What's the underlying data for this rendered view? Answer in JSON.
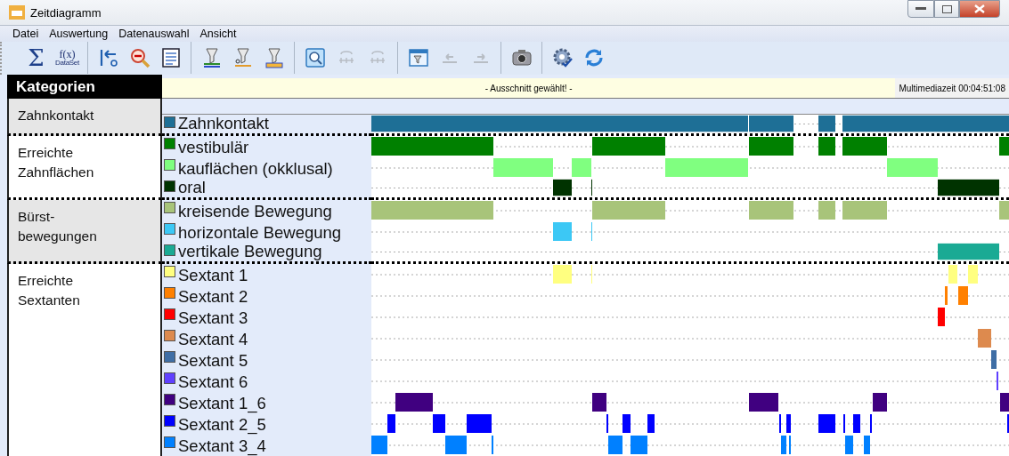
{
  "window": {
    "title": "Zeitdiagramm"
  },
  "menu": [
    "Datei",
    "Auswertung",
    "Datenauswahl",
    "Ansicht"
  ],
  "toolbar": [
    [
      {
        "kind": "sum",
        "text": "Σ",
        "disabled": false
      },
      {
        "kind": "function",
        "text": "f(x)",
        "subtext": "DataSet",
        "disabled": false
      }
    ],
    [
      {
        "kind": "reset",
        "disabled": false
      },
      {
        "kind": "zoom-out",
        "disabled": false
      },
      {
        "kind": "list",
        "disabled": false
      }
    ],
    [
      {
        "kind": "filter-lines",
        "disabled": false
      },
      {
        "kind": "filter-time",
        "disabled": false
      },
      {
        "kind": "filter-multi",
        "disabled": false
      }
    ],
    [
      {
        "kind": "zoom",
        "disabled": false
      },
      {
        "kind": "fit",
        "disabled": true
      },
      {
        "kind": "fit",
        "disabled": true
      }
    ],
    [
      {
        "kind": "filter-window",
        "disabled": false
      },
      {
        "kind": "prev",
        "disabled": true
      },
      {
        "kind": "next",
        "disabled": true
      }
    ],
    [
      {
        "kind": "camera",
        "disabled": false
      }
    ],
    [
      {
        "kind": "settings",
        "disabled": false
      },
      {
        "kind": "refresh",
        "disabled": false
      }
    ]
  ],
  "panel": {
    "header": "Kategorien"
  },
  "status": {
    "message": "- Ausschnitt gewählt! -",
    "time": "Multimediazeit 00:04:51:08"
  },
  "categories": [
    {
      "label": "Zahnkontakt",
      "rows": [
        {
          "name": "Zahnkontakt",
          "color": "#1e6f96"
        }
      ]
    },
    {
      "label": "Erreichte Zahnflächen",
      "rows": [
        {
          "name": "vestibulär",
          "color": "#008000"
        },
        {
          "name": "kauflächen (okklusal)",
          "color": "#80ff80"
        },
        {
          "name": "oral",
          "color": "#003300"
        }
      ]
    },
    {
      "label": "Bürst-bewegungen",
      "rows": [
        {
          "name": "kreisende Bewegung",
          "color": "#a8c47a"
        },
        {
          "name": "horizontale Bewegung",
          "color": "#3cc8f5"
        },
        {
          "name": "vertikale Bewegung",
          "color": "#1aaa94"
        }
      ]
    },
    {
      "label": "Erreichte Sextanten",
      "rows": [
        {
          "name": "Sextant 1",
          "color": "#ffff80"
        },
        {
          "name": "Sextant 2",
          "color": "#ff8000"
        },
        {
          "name": "Sextant 3",
          "color": "#ff0000"
        },
        {
          "name": "Sextant 4",
          "color": "#dd8a4e"
        },
        {
          "name": "Sextant 5",
          "color": "#3f6ea5"
        },
        {
          "name": "Sextant 6",
          "color": "#6040ff"
        },
        {
          "name": "Sextant 1_6",
          "color": "#400080"
        },
        {
          "name": "Sextant 2_5",
          "color": "#0000ff"
        },
        {
          "name": "Sextant 3_4",
          "color": "#0080ff"
        }
      ]
    }
  ]
}
